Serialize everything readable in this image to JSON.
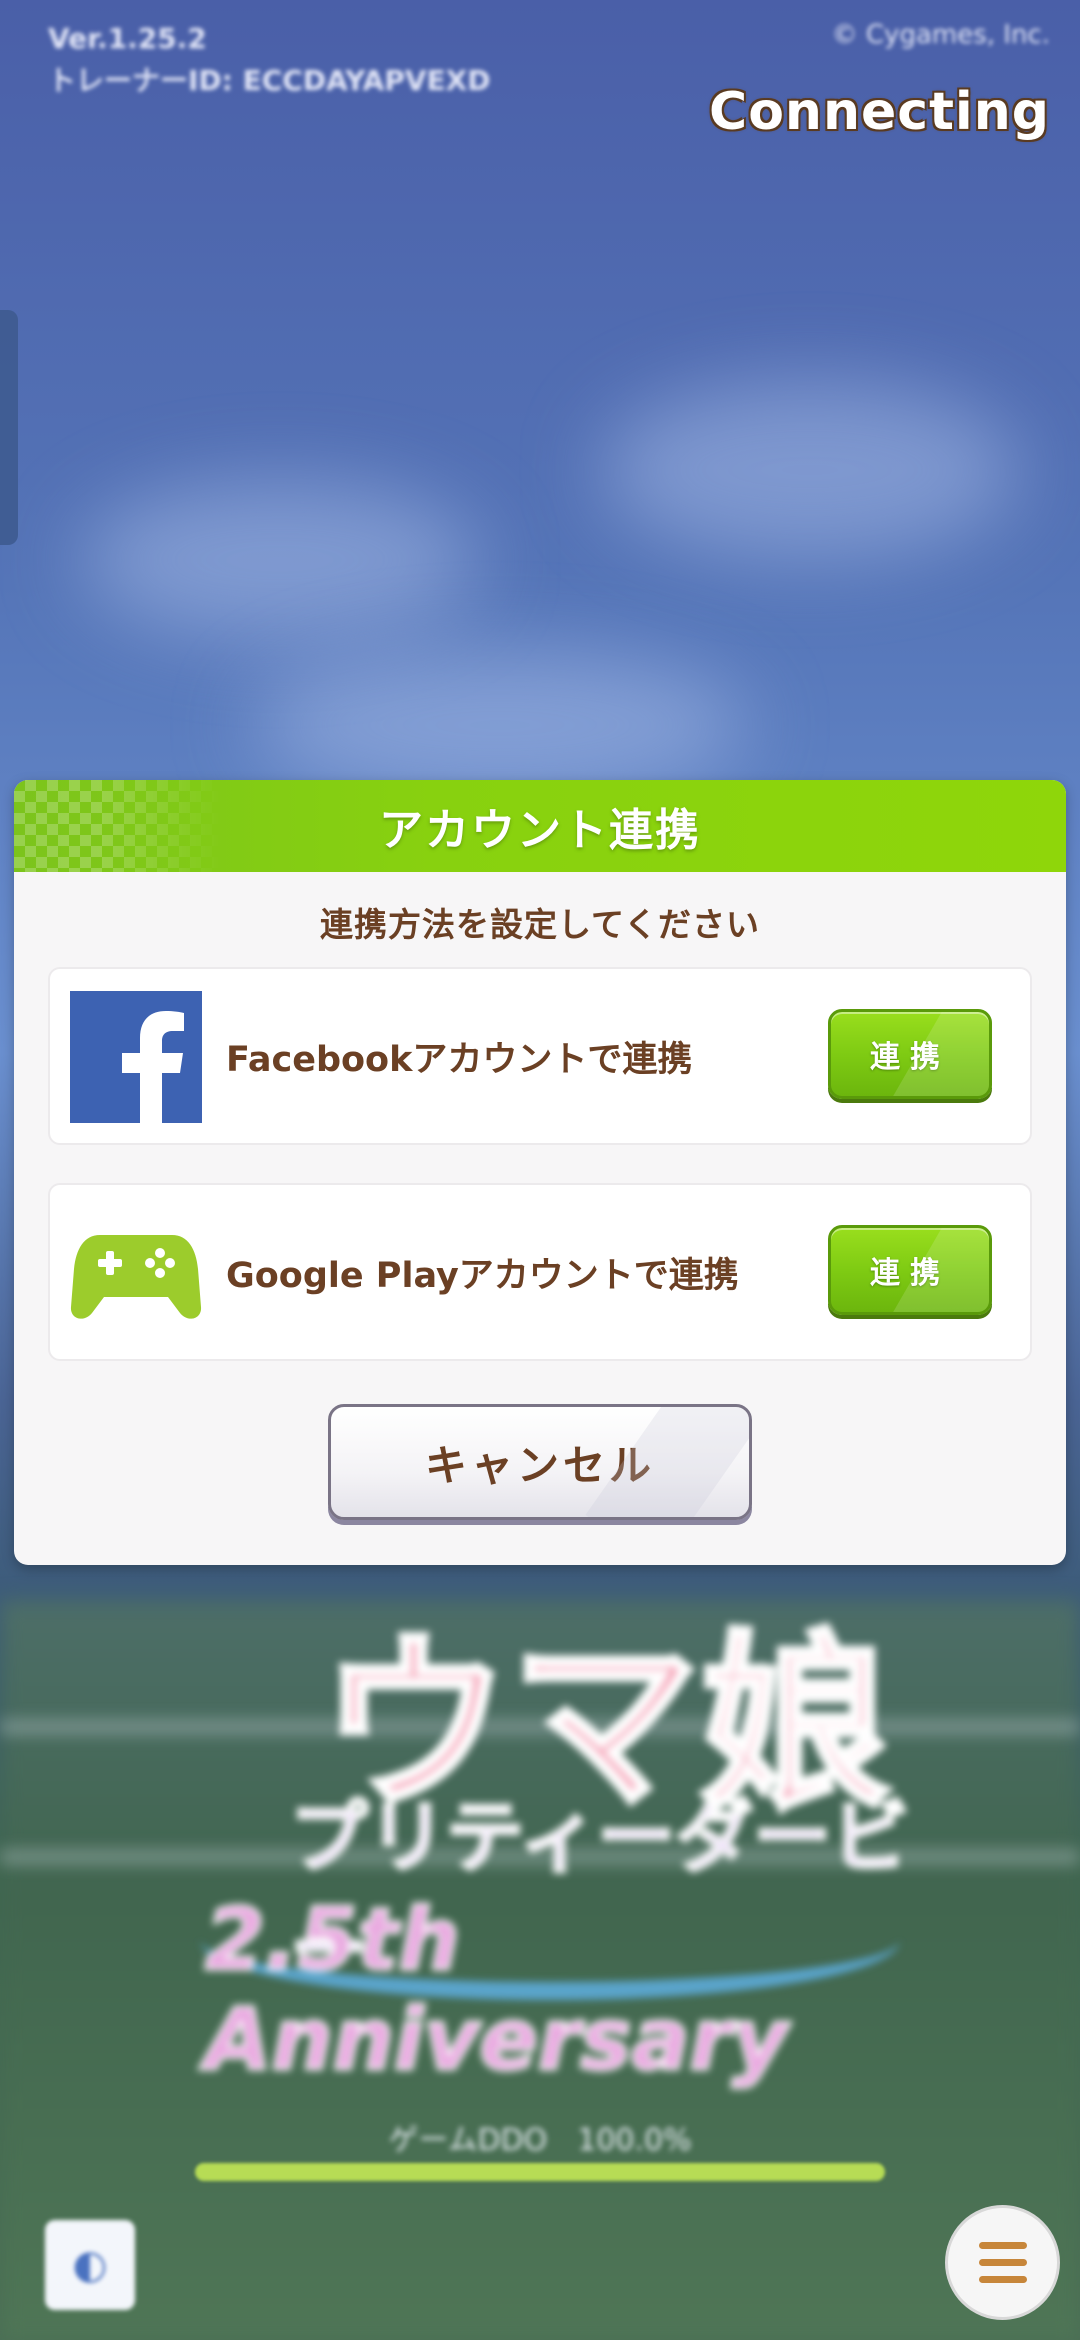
{
  "status": {
    "version_line1": "Ver.1.25.2",
    "version_line2": "トレーナーID: ECCDAYAPVEXD",
    "copyright": "© Cygames, Inc.",
    "connecting": "Connecting"
  },
  "background": {
    "logo_main": "ウマ娘",
    "logo_sub": "プリティーダービー",
    "logo_anniversary": "2.5th Anniversary",
    "loading_text": "ゲームDDO　100.0%",
    "progress": 1.0
  },
  "dialog": {
    "title": "アカウント連携",
    "subtitle": "連携方法を設定してください",
    "options": [
      {
        "icon": "facebook-icon",
        "label": "Facebookアカウントで連携",
        "button": "連携"
      },
      {
        "icon": "gamepad-icon",
        "label": "Google Playアカウントで連携",
        "button": "連携"
      }
    ],
    "cancel_label": "キャンセル"
  },
  "colors": {
    "header_green": "#8fd60a",
    "text_brown": "#6b4024",
    "facebook_blue": "#3d62b2",
    "gamepad_green": "#9ccc2c"
  }
}
